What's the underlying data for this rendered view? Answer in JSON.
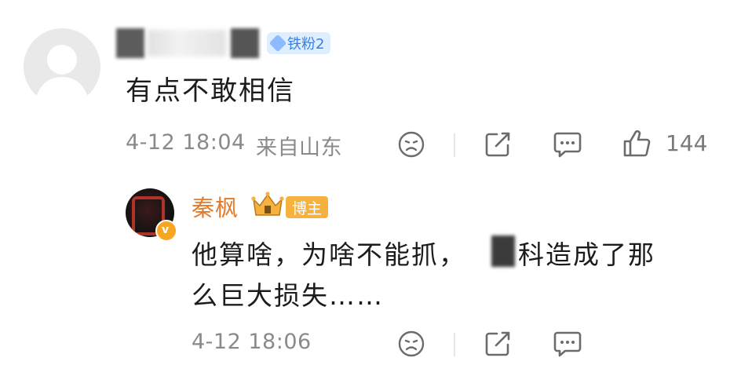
{
  "comment": {
    "badge_label": "铁粉2",
    "text": "有点不敢相信",
    "timestamp": "4-12 18:04",
    "location": "来自山东",
    "like_count": "144",
    "icons": [
      "dislike-icon",
      "share-icon",
      "comment-icon",
      "like-icon"
    ]
  },
  "reply": {
    "author": "秦枫",
    "badge_label": "博主",
    "text_line1_a": "他算啥，为啥不能抓，",
    "text_line1_b": "科造成了那",
    "text_line2": "么巨大损失……",
    "timestamp": "4-12 18:06",
    "icons": [
      "dislike-icon",
      "share-icon",
      "comment-icon"
    ]
  },
  "colors": {
    "accent_name": "#e57a2a",
    "badge_blogger": "#f6b13e",
    "badge_fan_bg": "#dfeeff",
    "meta_text": "#8a8a8a"
  }
}
